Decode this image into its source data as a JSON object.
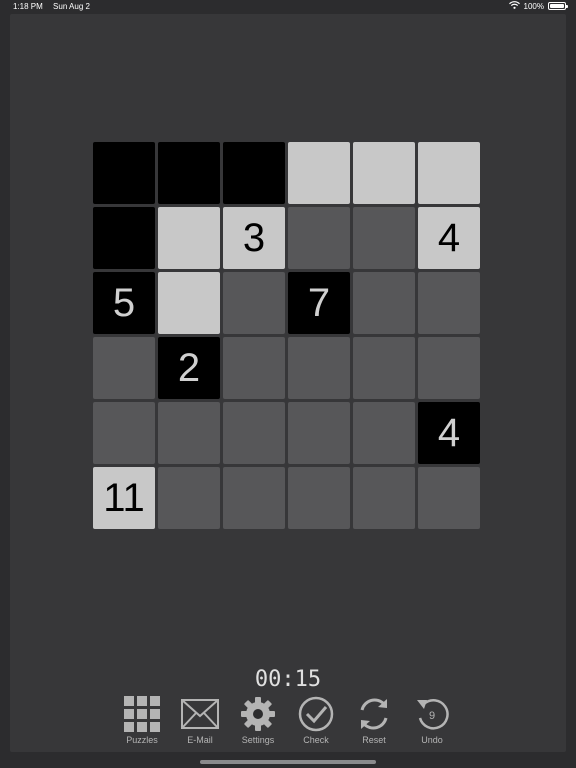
{
  "status_bar": {
    "time": "1:18 PM",
    "date": "Sun Aug 2",
    "battery": "100%",
    "icons": [
      "wifi-icon",
      "battery-icon"
    ]
  },
  "board": {
    "rows": 6,
    "cols": 6,
    "cells": [
      [
        {
          "state": "black",
          "label": ""
        },
        {
          "state": "black",
          "label": ""
        },
        {
          "state": "black",
          "label": ""
        },
        {
          "state": "white",
          "label": ""
        },
        {
          "state": "white",
          "label": ""
        },
        {
          "state": "white",
          "label": ""
        }
      ],
      [
        {
          "state": "black",
          "label": ""
        },
        {
          "state": "white",
          "label": ""
        },
        {
          "state": "white",
          "label": "3"
        },
        {
          "state": "unknown",
          "label": ""
        },
        {
          "state": "unknown",
          "label": ""
        },
        {
          "state": "white",
          "label": "4"
        }
      ],
      [
        {
          "state": "black",
          "label": "5"
        },
        {
          "state": "white",
          "label": ""
        },
        {
          "state": "unknown",
          "label": ""
        },
        {
          "state": "black",
          "label": "7"
        },
        {
          "state": "unknown",
          "label": ""
        },
        {
          "state": "unknown",
          "label": ""
        }
      ],
      [
        {
          "state": "unknown",
          "label": ""
        },
        {
          "state": "black",
          "label": "2"
        },
        {
          "state": "unknown",
          "label": ""
        },
        {
          "state": "unknown",
          "label": ""
        },
        {
          "state": "unknown",
          "label": ""
        },
        {
          "state": "unknown",
          "label": ""
        }
      ],
      [
        {
          "state": "unknown",
          "label": ""
        },
        {
          "state": "unknown",
          "label": ""
        },
        {
          "state": "unknown",
          "label": ""
        },
        {
          "state": "unknown",
          "label": ""
        },
        {
          "state": "unknown",
          "label": ""
        },
        {
          "state": "black",
          "label": "4"
        }
      ],
      [
        {
          "state": "white",
          "label": "11"
        },
        {
          "state": "unknown",
          "label": ""
        },
        {
          "state": "unknown",
          "label": ""
        },
        {
          "state": "unknown",
          "label": ""
        },
        {
          "state": "unknown",
          "label": ""
        },
        {
          "state": "unknown",
          "label": ""
        }
      ]
    ]
  },
  "timer": "00:15",
  "toolbar": {
    "puzzles": "Puzzles",
    "email": "E-Mail",
    "settings": "Settings",
    "check": "Check",
    "reset": "Reset",
    "undo": "Undo",
    "undo_count": "9"
  },
  "colors": {
    "background": "#2c2c2e",
    "panel": "#373739",
    "cell_black": "#000000",
    "cell_white": "#c8c8c8",
    "cell_unknown": "#575759",
    "icon": "#b4b4b4"
  }
}
